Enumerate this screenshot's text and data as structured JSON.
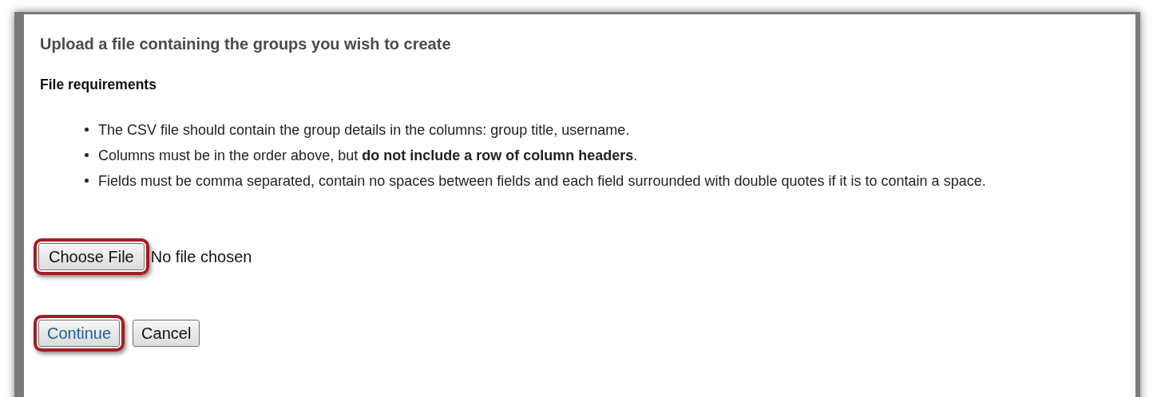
{
  "heading": "Upload a file containing the groups you wish to create",
  "subheading": "File requirements",
  "requirements": [
    "The CSV file should contain the group details in the columns: group title, username.",
    "Columns must be in the order above, but **do not include a row of column headers**.",
    "Fields must be comma separated, contain no spaces between fields and each field surrounded with double quotes if it is to contain a space."
  ],
  "file_input": {
    "button": "Choose File",
    "status": "No file chosen",
    "highlighted": true
  },
  "buttons": [
    {
      "label": "Continue",
      "kind": "primary",
      "highlighted": true
    },
    {
      "label": "Cancel",
      "kind": "secondary",
      "highlighted": false
    }
  ]
}
